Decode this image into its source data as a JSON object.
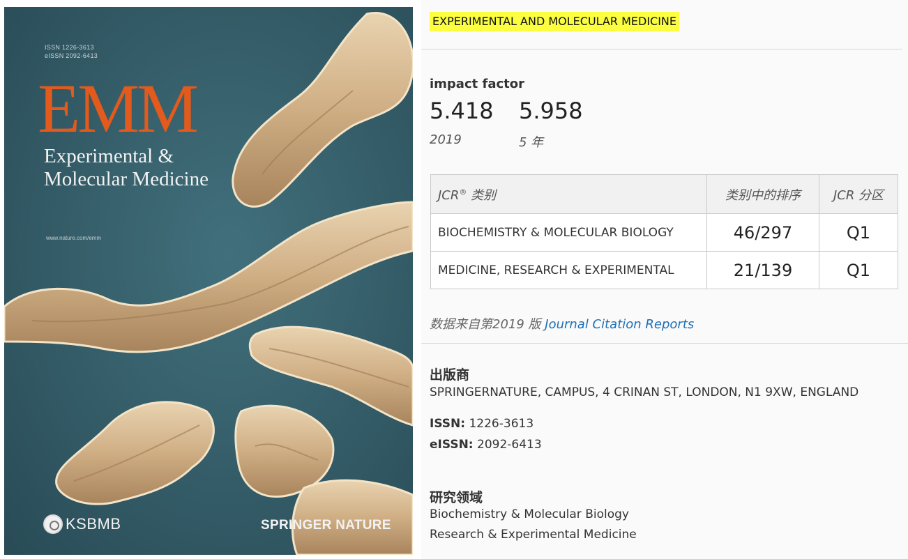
{
  "cover": {
    "issn_print": "ISSN 1226-3613",
    "issn_online": "eISSN 2092-6413",
    "logo": "EMM",
    "title_line1": "Experimental &",
    "title_line2": "Molecular Medicine",
    "url": "www.nature.com/emm",
    "society": "KSBMB",
    "publisher_brand": "SPRINGER NATURE",
    "colors": {
      "background": "#365f6b",
      "logo": "#e25a1c",
      "specimen": "#d1b48c"
    }
  },
  "journal_name": "EXPERIMENTAL AND MOLECULAR MEDICINE",
  "impact_factor": {
    "label": "impact factor",
    "value_2019": "5.418",
    "value_5yr": "5.958",
    "label_2019": "2019",
    "label_5yr": "5 年"
  },
  "jcr_table": {
    "headers": [
      "JCR",
      "类别",
      "类别中的排序",
      "JCR 分区"
    ],
    "rows": [
      {
        "category": "BIOCHEMISTRY & MOLECULAR BIOLOGY",
        "rank": "46/297",
        "quartile": "Q1"
      },
      {
        "category": "MEDICINE, RESEARCH & EXPERIMENTAL",
        "rank": "21/139",
        "quartile": "Q1"
      }
    ]
  },
  "source": {
    "prefix": "数据来自第2019 版",
    "link": "Journal Citation Reports"
  },
  "publisher": {
    "heading": "出版商",
    "address": "SPRINGERNATURE, CAMPUS, 4 CRINAN ST, LONDON, N1 9XW, ENGLAND",
    "issn_label": "ISSN:",
    "issn": "1226-3613",
    "eissn_label": "eISSN:",
    "eissn": "2092-6413"
  },
  "research": {
    "heading": "研究领域",
    "areas": [
      "Biochemistry & Molecular Biology",
      "Research & Experimental Medicine"
    ]
  },
  "highlight_color": "#fbff40",
  "link_color": "#1d6fb5"
}
